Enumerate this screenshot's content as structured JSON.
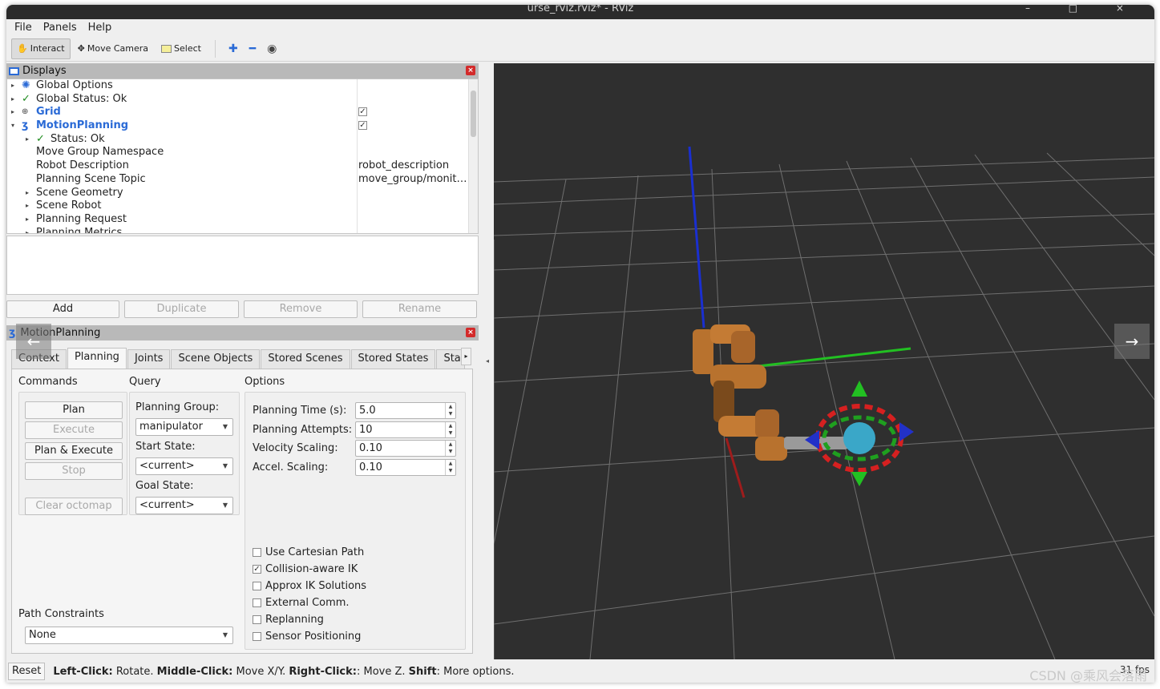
{
  "window": {
    "title": "urse_rviz.rviz* - RViz"
  },
  "menu": {
    "file": "File",
    "panels": "Panels",
    "help": "Help"
  },
  "toolbar": {
    "interact": "Interact",
    "move_camera": "Move Camera",
    "select": "Select",
    "plus_icon": "plus-icon",
    "minus_icon": "minus-icon",
    "eye_icon": "eye-icon"
  },
  "displays": {
    "title": "Displays",
    "rows": [
      {
        "label": "Global Options",
        "value": ""
      },
      {
        "label": "Global Status: Ok",
        "value": ""
      },
      {
        "label": "Grid",
        "value": ""
      },
      {
        "label": "MotionPlanning",
        "value": ""
      },
      {
        "label": "Status: Ok",
        "value": ""
      },
      {
        "label": "Move Group Namespace",
        "value": ""
      },
      {
        "label": "Robot Description",
        "value": "robot_description"
      },
      {
        "label": "Planning Scene Topic",
        "value": "move_group/monit…"
      },
      {
        "label": "Scene Geometry",
        "value": ""
      },
      {
        "label": "Scene Robot",
        "value": ""
      },
      {
        "label": "Planning Request",
        "value": ""
      },
      {
        "label": "Planning Metrics",
        "value": ""
      }
    ],
    "grid_checked": true,
    "motion_checked": true,
    "buttons": {
      "add": "Add",
      "duplicate": "Duplicate",
      "remove": "Remove",
      "rename": "Rename"
    }
  },
  "motion_planning": {
    "title": "MotionPlanning",
    "tabs": [
      "Context",
      "Planning",
      "Joints",
      "Scene Objects",
      "Stored Scenes",
      "Stored States",
      "Stat"
    ],
    "active_tab": "Planning",
    "commands": {
      "title": "Commands",
      "plan": "Plan",
      "execute": "Execute",
      "plan_execute": "Plan & Execute",
      "stop": "Stop",
      "clear_octomap": "Clear octomap"
    },
    "query": {
      "title": "Query",
      "planning_group_label": "Planning Group:",
      "planning_group": "manipulator",
      "start_state_label": "Start State:",
      "start_state": "<current>",
      "goal_state_label": "Goal State:",
      "goal_state": "<current>"
    },
    "options": {
      "title": "Options",
      "planning_time_label": "Planning Time (s):",
      "planning_time": "5.0",
      "planning_attempts_label": "Planning Attempts:",
      "planning_attempts": "10",
      "velocity_scaling_label": "Velocity Scaling:",
      "velocity_scaling": "0.10",
      "accel_scaling_label": "Accel. Scaling:",
      "accel_scaling": "0.10",
      "checkboxes": [
        {
          "label": "Use Cartesian Path",
          "checked": false
        },
        {
          "label": "Collision-aware IK",
          "checked": true
        },
        {
          "label": "Approx IK Solutions",
          "checked": false
        },
        {
          "label": "External Comm.",
          "checked": false
        },
        {
          "label": "Replanning",
          "checked": false
        },
        {
          "label": "Sensor Positioning",
          "checked": false
        }
      ]
    },
    "path_constraints": {
      "title": "Path Constraints",
      "value": "None"
    }
  },
  "status": {
    "reset": "Reset",
    "lc": "Left-Click:",
    "lc_t": " Rotate. ",
    "mc": "Middle-Click:",
    "mc_t": " Move X/Y. ",
    "rc": "Right-Click:",
    "rc_t": ": Move Z. ",
    "sh": "Shift",
    "sh_t": ": More options.",
    "fps": "31 fps"
  },
  "watermark": "CSDN @乘风会落雨",
  "colors": {
    "viewport_bg": "#2f2f2f",
    "grid": "#7a7a7a",
    "robot": "#b8722e",
    "accent": "#2a6ad6"
  }
}
